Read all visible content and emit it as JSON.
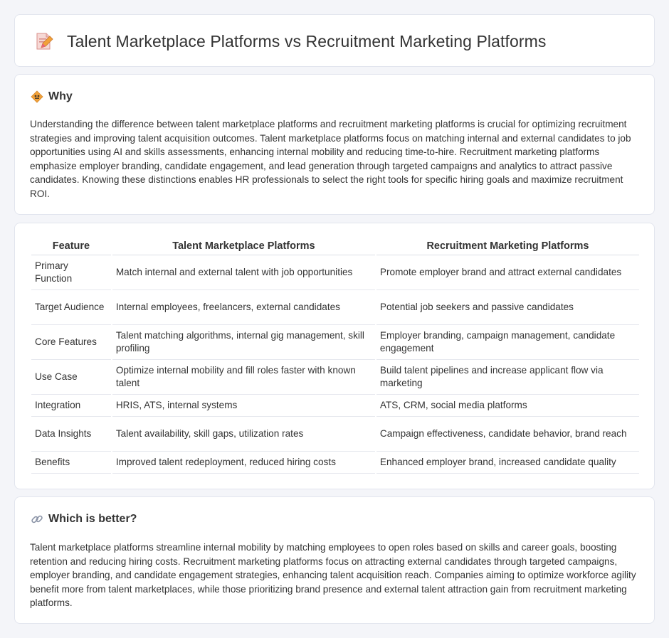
{
  "header": {
    "title": "Talent Marketplace Platforms vs Recruitment Marketing Platforms",
    "icon": "document-pencil-icon"
  },
  "why": {
    "icon": "diamond-sign-icon",
    "title": "Why",
    "text": "Understanding the difference between talent marketplace platforms and recruitment marketing platforms is crucial for optimizing recruitment strategies and improving talent acquisition outcomes. Talent marketplace platforms focus on matching internal and external candidates to job opportunities using AI and skills assessments, enhancing internal mobility and reducing time-to-hire. Recruitment marketing platforms emphasize employer branding, candidate engagement, and lead generation through targeted campaigns and analytics to attract passive candidates. Knowing these distinctions enables HR professionals to select the right tools for specific hiring goals and maximize recruitment ROI."
  },
  "table": {
    "headers": [
      "Feature",
      "Talent Marketplace Platforms",
      "Recruitment Marketing Platforms"
    ],
    "rows": [
      [
        "Primary Function",
        "Match internal and external talent with job opportunities",
        "Promote employer brand and attract external candidates"
      ],
      [
        "Target Audience",
        "Internal employees, freelancers, external candidates",
        "Potential job seekers and passive candidates"
      ],
      [
        "Core Features",
        "Talent matching algorithms, internal gig management, skill profiling",
        "Employer branding, campaign management, candidate engagement"
      ],
      [
        "Use Case",
        "Optimize internal mobility and fill roles faster with known talent",
        "Build talent pipelines and increase applicant flow via marketing"
      ],
      [
        "Integration",
        "HRIS, ATS, internal systems",
        "ATS, CRM, social media platforms"
      ],
      [
        "Data Insights",
        "Talent availability, skill gaps, utilization rates",
        "Campaign effectiveness, candidate behavior, brand reach"
      ],
      [
        "Benefits",
        "Improved talent redeployment, reduced hiring costs",
        "Enhanced employer brand, increased candidate quality"
      ]
    ]
  },
  "better": {
    "icon": "link-icon",
    "title": "Which is better?",
    "text": "Talent marketplace platforms streamline internal mobility by matching employees to open roles based on skills and career goals, boosting retention and reducing hiring costs. Recruitment marketing platforms focus on attracting external candidates through targeted campaigns, employer branding, and candidate engagement strategies, enhancing talent acquisition reach. Companies aiming to optimize workforce agility benefit more from talent marketplaces, while those prioritizing brand presence and external talent attraction gain from recruitment marketing platforms."
  },
  "colors": {
    "page_bg": "#f4f5f9",
    "card_bg": "#ffffff",
    "text": "#333333",
    "icon_orange": "#f2a23a",
    "icon_pink": "#e9637b"
  }
}
